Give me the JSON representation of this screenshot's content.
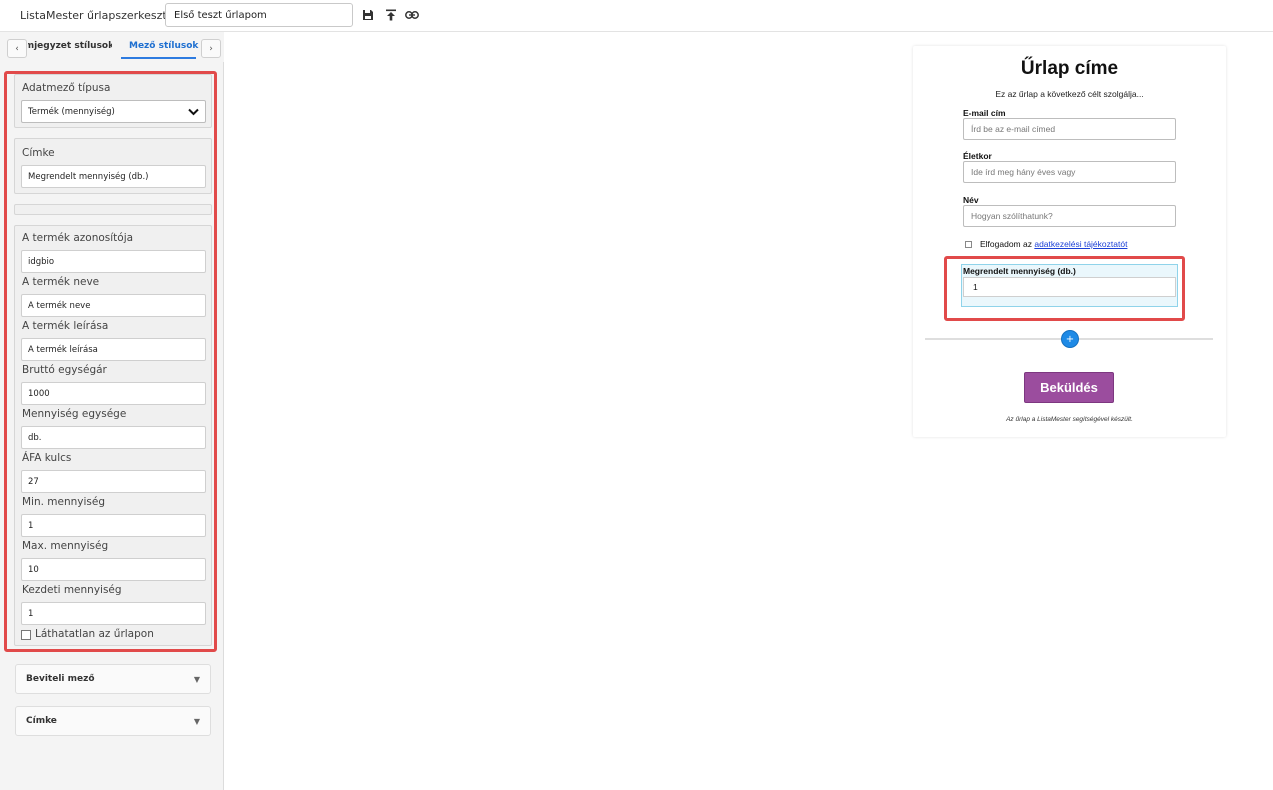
{
  "topbar": {
    "app_title": "ListaMester űrlapszerkesztő:",
    "form_name": "Első teszt űrlapom",
    "icons": [
      "save-icon",
      "upload-icon",
      "link-icon"
    ]
  },
  "sidebar": {
    "tabs": {
      "prev_arrow": "‹",
      "next_arrow": "›",
      "left_tab": "Címjegyzet stílusok",
      "active_tab": "Mező stílusok"
    },
    "field_type": {
      "label": "Adatmező típusa",
      "value": "Termék (mennyiség)"
    },
    "label_section": {
      "label": "Címke",
      "value": "Megrendelt mennyiség (db.)"
    },
    "product_fields": [
      {
        "label": "A termék azonosítója",
        "value": "idgbio"
      },
      {
        "label": "A termék neve",
        "value": "A termék neve"
      },
      {
        "label": "A termék leírása",
        "value": "A termék leírása"
      },
      {
        "label": "Bruttó egységár",
        "value": "1000"
      },
      {
        "label": "Mennyiség egysége",
        "value": "db."
      },
      {
        "label": "ÁFA kulcs",
        "value": "27"
      },
      {
        "label": "Min. mennyiség",
        "value": "1"
      },
      {
        "label": "Max. mennyiség",
        "value": "10"
      },
      {
        "label": "Kezdeti mennyiség",
        "value": "1"
      }
    ],
    "invisible_checkbox": {
      "label": "Láthatatlan az űrlapon",
      "checked": false
    },
    "accordions": [
      {
        "label": "Beviteli mező",
        "arrow": "▼"
      },
      {
        "label": "Címke",
        "arrow": "▼"
      }
    ]
  },
  "form": {
    "title": "Űrlap címe",
    "subtitle": "Ez az űrlap a következő célt szolgálja...",
    "fields": [
      {
        "label": "E-mail cím",
        "placeholder": "Írd be az e-mail címed"
      },
      {
        "label": "Életkor",
        "placeholder": "Ide írd meg hány éves vagy"
      },
      {
        "label": "Név",
        "placeholder": "Hogyan szólíthatunk?"
      }
    ],
    "consent": {
      "prefix": "Elfogadom az ",
      "link": "adatkezelési tájékoztatót"
    },
    "quantity": {
      "label": "Megrendelt mennyiség (db.)",
      "value": "1"
    },
    "add_button": "+",
    "submit": "Beküldés",
    "footer": "Az űrlap a ListaMester segítségével készült."
  },
  "colors": {
    "accent": "#2d7be0",
    "highlight": "#e14a4a",
    "submit": "#9b4d9e",
    "selected_block": "#eaf7fc"
  }
}
